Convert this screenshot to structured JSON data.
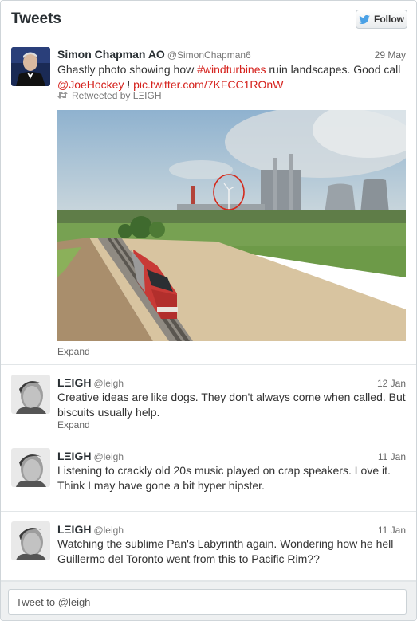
{
  "header": {
    "title": "Tweets",
    "follow_label": "Follow"
  },
  "tweets": [
    {
      "name": "Simon Chapman AO",
      "handle": "@SimonChapman6",
      "date": "29 May",
      "text_plain_1": "Ghastly photo showing how ",
      "hashtag": "#windturbines",
      "text_plain_2": " ruin landscapes. Good call ",
      "mention": "@JoeHockey",
      "text_plain_3": " ! ",
      "pic_link": "pic.twitter.com/7KFCC1ROnW",
      "retweeted_by": "Retweeted by LΞIGH",
      "expand": "Expand"
    },
    {
      "name": "LΞIGH",
      "handle": "@leigh",
      "date": "12 Jan",
      "text": "Creative ideas are like dogs. They don't always come when called. But biscuits usually help.",
      "expand": "Expand"
    },
    {
      "name": "LΞIGH",
      "handle": "@leigh",
      "date": "11 Jan",
      "text": "Listening to crackly old 20s music played on crap speakers.  Love it. Think I may have gone a bit hyper hipster."
    },
    {
      "name": "LΞIGH",
      "handle": "@leigh",
      "date": "11 Jan",
      "text": "Watching the sublime Pan's Labyrinth again. Wondering how he hell Guillermo del Toronto went from this to Pacific Rim??"
    }
  ],
  "composer": {
    "placeholder": "Tweet to @leigh"
  },
  "colors": {
    "link": "#d5211c",
    "twitter_blue": "#4aa1e6"
  },
  "icons": [
    "twitter-bird-icon",
    "retweet-icon"
  ]
}
